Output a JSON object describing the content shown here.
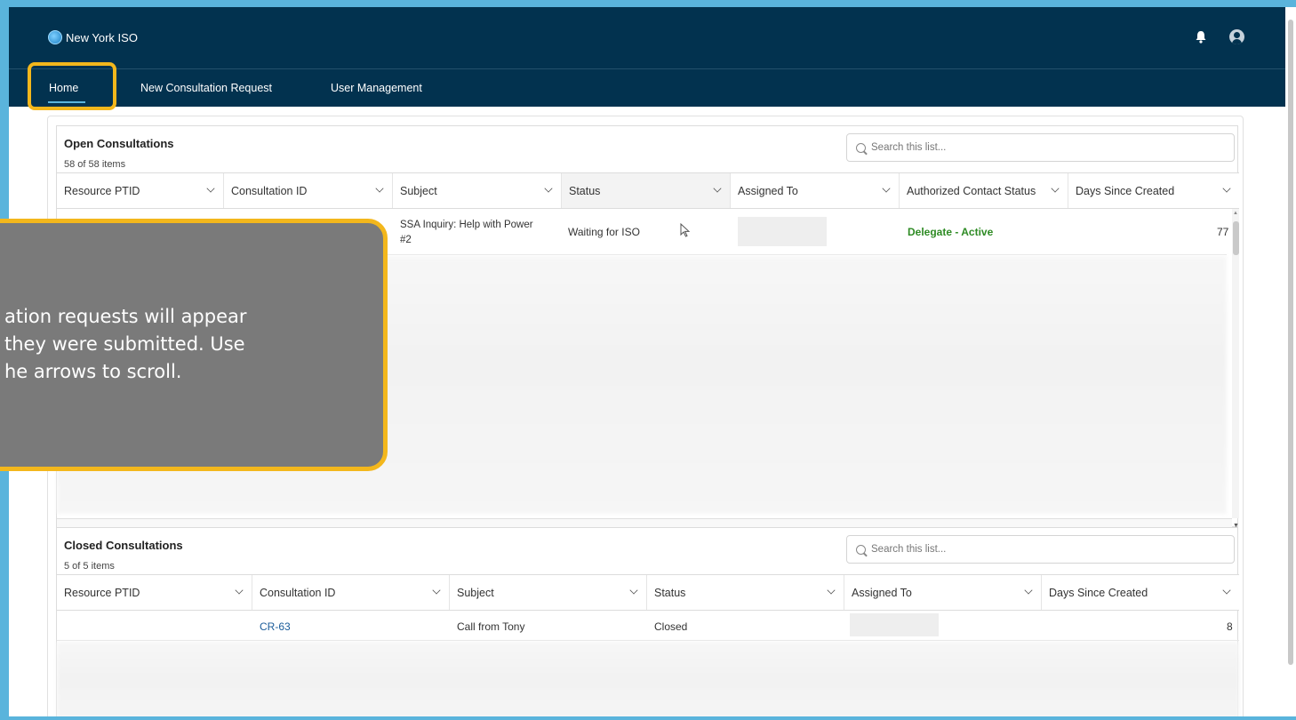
{
  "app": {
    "brand": "New York ISO"
  },
  "nav": {
    "items": [
      {
        "label": "Home"
      },
      {
        "label": "New Consultation Request"
      },
      {
        "label": "User Management"
      }
    ]
  },
  "open_panel": {
    "title": "Open Consultations",
    "count": "58 of 58 items",
    "search_placeholder": "Search this list...",
    "columns": [
      "Resource PTID",
      "Consultation ID",
      "Subject",
      "Status",
      "Assigned To",
      "Authorized Contact Status",
      "Days Since Created"
    ],
    "rows": [
      {
        "subject_line1": "SSA Inquiry: Help with Power",
        "subject_line2": "#2",
        "status": "Waiting for ISO",
        "authorized_contact_status": "Delegate - Active",
        "days_since_created": "77"
      }
    ]
  },
  "closed_panel": {
    "title": "Closed Consultations",
    "count": "5 of 5 items",
    "search_placeholder": "Search this list...",
    "columns": [
      "Resource PTID",
      "Consultation ID",
      "Subject",
      "Status",
      "Assigned To",
      "Days Since Created"
    ],
    "rows": [
      {
        "consultation_id": "CR-63",
        "subject": "Call from Tony",
        "status": "Closed",
        "days_since_created": "8"
      }
    ]
  },
  "tooltip": {
    "lines": [
      "ation requests will appear",
      " they were submitted. Use",
      "he arrows to scroll."
    ]
  },
  "colors": {
    "header": "#02324f",
    "highlight": "#f3b71c",
    "link": "#1b5c9a",
    "active_status": "#2e8b24"
  }
}
